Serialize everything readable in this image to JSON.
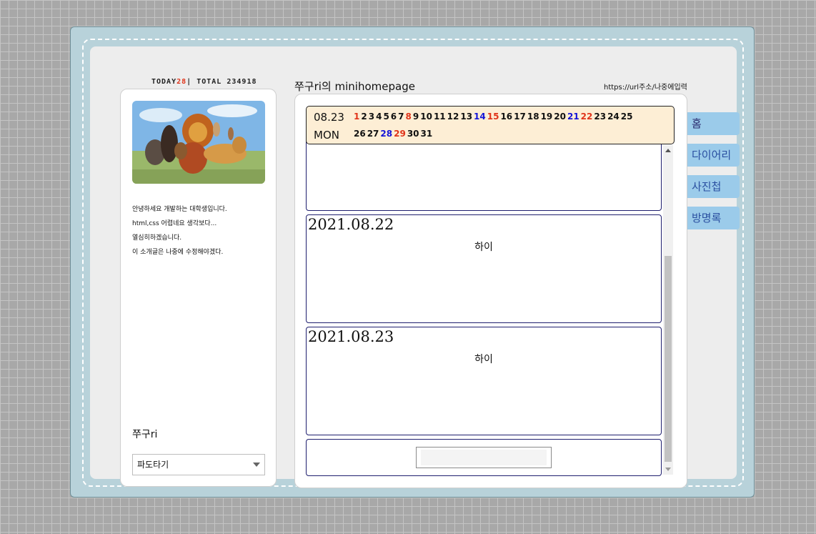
{
  "counter": {
    "today_label": "TODAY",
    "today_value": "28",
    "separator": "|",
    "total_label": "TOTAL",
    "total_value": "234918"
  },
  "profile": {
    "image_alt": "lion-king-characters",
    "intro": [
      "안녕하세요 개발하는 대학생입니다.",
      "html,css 어렵네요 생각보다...",
      "열심히하겠습니다.",
      "이 소개글은 나중에 수정해야겠다."
    ],
    "name": "쭈구ri",
    "dropdown_selected": "파도타기"
  },
  "header": {
    "title": "쭈구ri의 minihomepage",
    "url": "https://url주소/나중에입력"
  },
  "calendar": {
    "date": "08.23",
    "weekday": "MON",
    "row1": [
      "1",
      "2",
      "3",
      "4",
      "5",
      "6",
      "7",
      "8",
      "9",
      "10",
      "11",
      "12",
      "13",
      "14",
      "15",
      "16",
      "17",
      "18",
      "19",
      "20",
      "21",
      "22",
      "23",
      "24",
      "25"
    ],
    "row2": [
      "26",
      "27",
      "28",
      "29",
      "30",
      "31"
    ],
    "sundays": [
      "1",
      "8",
      "15",
      "22",
      "29"
    ],
    "saturdays": [
      "14",
      "21",
      "28"
    ],
    "colors": {
      "sunday": "#e0341a",
      "saturday": "#1414d8",
      "weekday": "#111111",
      "background": "#fdeed5"
    }
  },
  "posts": [
    {
      "date": "",
      "body": ""
    },
    {
      "date": "2021.08.22",
      "body": "하이"
    },
    {
      "date": "2021.08.23",
      "body": "하이"
    }
  ],
  "comment": {
    "value": ""
  },
  "tabs": [
    {
      "label": "홈",
      "active": true
    },
    {
      "label": "다이어리",
      "active": false
    },
    {
      "label": "사진첩",
      "active": false
    },
    {
      "label": "방명록",
      "active": false
    }
  ],
  "icons": {
    "dropdown": "chevron-down-icon",
    "scroll_up": "arrow-up-icon",
    "scroll_down": "arrow-down-icon"
  },
  "colors": {
    "frame": "#b8d2da",
    "inner": "#ededed",
    "tab": "#9bcbea",
    "post_border": "#1e1e6e"
  }
}
